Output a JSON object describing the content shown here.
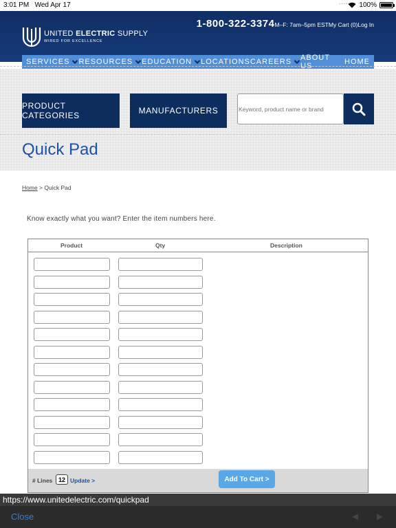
{
  "status": {
    "time": "3:01 PM",
    "date": "Wed Apr 17",
    "battery": "100%"
  },
  "header": {
    "brand_part1": "UNITED ",
    "brand_part2": "ELECTRIC",
    "brand_part3": " SUPPLY",
    "tagline": "WIRED FOR EXCELLENCE",
    "phone": "1-800-322-3374",
    "hours": "M–F: 7am–5pm EST",
    "cart": "My Cart (0)",
    "login": "Log In"
  },
  "nav": [
    {
      "label": "SERVICES",
      "dropdown": true
    },
    {
      "label": "RESOURCES",
      "dropdown": true
    },
    {
      "label": "EDUCATION",
      "dropdown": true
    },
    {
      "label": "LOCATIONS",
      "dropdown": false
    },
    {
      "label": "CAREERS",
      "dropdown": true
    },
    {
      "label": "ABOUT US",
      "dropdown": false
    },
    {
      "label": "HOME",
      "dropdown": false
    }
  ],
  "hero": {
    "product_categories": "PRODUCT CATEGORIES",
    "manufacturers": "MANUFACTURERS",
    "search_placeholder": "Keyword, product name or brand",
    "title": "Quick Pad"
  },
  "breadcrumb": {
    "home": "Home",
    "separator": " > ",
    "current": "Quick Pad"
  },
  "intro": "Know exactly what you want? Enter the item numbers here.",
  "table": {
    "col_product": "Product",
    "col_qty": "Qty",
    "col_description": "Description",
    "row_count": 12
  },
  "footer": {
    "lines_label": "# Lines",
    "lines_value": "12",
    "update": "Update >",
    "add_to_cart": "Add To Cart >"
  },
  "browser": {
    "url": "https://www.unitedelectric.com/quickpad",
    "close": "Close"
  },
  "colors": {
    "header_bg": "#173a7a",
    "nav_bg": "#4f8fda",
    "button_dark": "#0d2d5e",
    "title_blue": "#1b52a8",
    "add_cart_bg": "#5aa7e8"
  }
}
